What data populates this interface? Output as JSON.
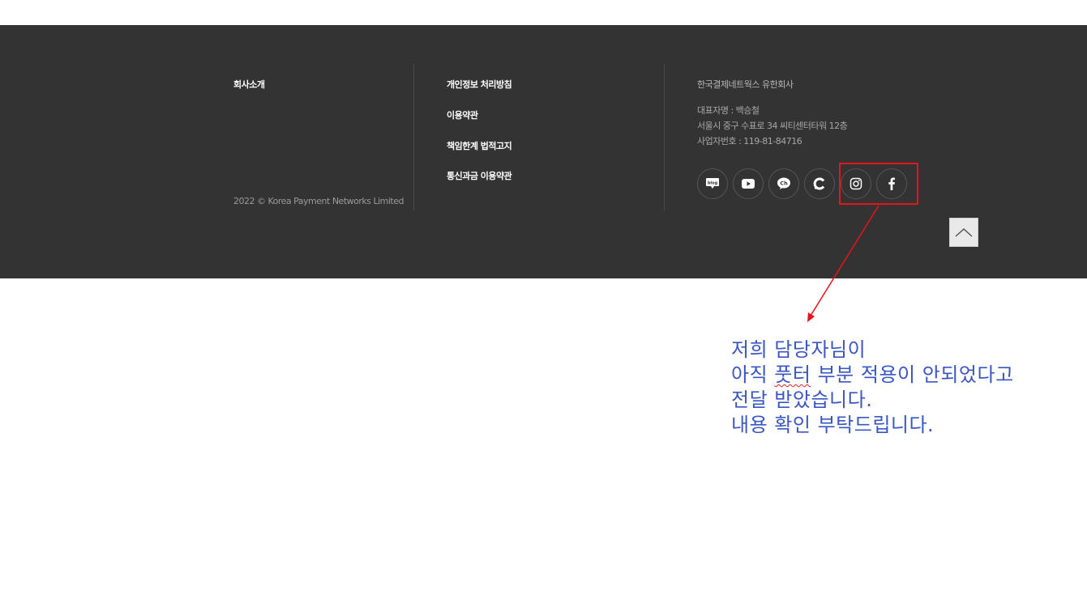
{
  "footer": {
    "company_intro_link": "회사소개",
    "links": [
      "개인정보 처리방침",
      "이용약관",
      "책임한계 법적고지",
      "통신과금 이용약관"
    ],
    "copyright": "2022 © Korea Payment Networks Limited",
    "company_name": "한국결제네트웍스 유한회사",
    "ceo": "대표자명 : 백승철",
    "address": "서울시 중구 수표로 34 씨티센터타워 12층",
    "business_number": "사업자번호 : 119-81-84716",
    "social_icons": [
      "blog-icon",
      "youtube-icon",
      "kakao-channel-icon",
      "c-icon",
      "instagram-icon",
      "facebook-icon"
    ],
    "background_color": "#333333"
  },
  "annotation": {
    "highlight_color": "#e8141b",
    "note_lines": [
      "저희 담당자님이",
      "아직 풋터 부분 적용이 안되었다고",
      "전달 받았습니다.",
      "내용 확인 부탁드립니다."
    ],
    "note_line2_prefix": "아직 ",
    "note_line2_marked": "풋터",
    "note_line2_suffix": " 부분 적용이 안되었다고",
    "note_color": "#3a55c4"
  }
}
